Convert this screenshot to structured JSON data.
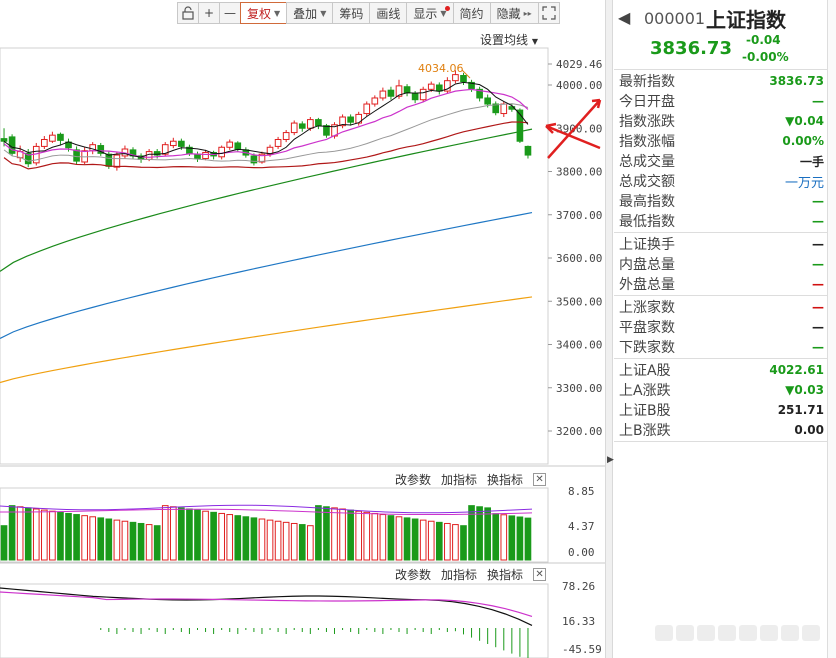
{
  "toolbar": {
    "items": [
      {
        "label": "",
        "icon": "lock-icon"
      },
      {
        "label": "+",
        "icon": "zoom-in-icon"
      },
      {
        "label": "—",
        "icon": "zoom-out-icon"
      },
      {
        "label": "复权",
        "dropdown": true,
        "active": true
      },
      {
        "label": "叠加",
        "dropdown": true
      },
      {
        "label": "筹码"
      },
      {
        "label": "画线"
      },
      {
        "label": "显示",
        "dropdown": true,
        "badge": true
      },
      {
        "label": "简约"
      },
      {
        "label": "隐藏",
        "suffix": "▸▸"
      },
      {
        "label": "",
        "icon": "fullscreen-icon"
      }
    ]
  },
  "main_chart": {
    "setting_label": "设置均线",
    "high_label": "4034.06",
    "y_axis_ticks": [
      "4029.46",
      "4000.00",
      "3900.00",
      "3800.00",
      "3700.00",
      "3600.00",
      "3500.00",
      "3400.00",
      "3300.00",
      "3200.00"
    ]
  },
  "volume_panel": {
    "buttons": [
      "改参数",
      "加指标",
      "换指标"
    ],
    "y_axis_ticks": [
      "8.85",
      "4.37",
      "0.00"
    ]
  },
  "macd_panel": {
    "buttons": [
      "改参数",
      "加指标",
      "换指标"
    ],
    "y_axis_ticks": [
      "78.26",
      "16.33",
      "-45.59"
    ]
  },
  "quote": {
    "code": "000001",
    "name": "上证指数",
    "price": "3836.73",
    "change": "-0.04",
    "change_pct": "-0.00%",
    "groups": [
      [
        {
          "label": "最新指数",
          "value": "3836.73",
          "color": "green"
        },
        {
          "label": "今日开盘",
          "value": "—",
          "color": "green"
        },
        {
          "label": "指数涨跌",
          "value": "▼0.04",
          "color": "green"
        },
        {
          "label": "指数涨幅",
          "value": "0.00%",
          "color": "green"
        },
        {
          "label": "总成交量",
          "value": "一手",
          "color": "dark"
        },
        {
          "label": "总成交额",
          "value": "一万元",
          "color": "blue"
        },
        {
          "label": "最高指数",
          "value": "—",
          "color": "green"
        },
        {
          "label": "最低指数",
          "value": "—",
          "color": "green"
        }
      ],
      [
        {
          "label": "上证换手",
          "value": "—",
          "color": "dark"
        },
        {
          "label": "内盘总量",
          "value": "—",
          "color": "green"
        },
        {
          "label": "外盘总量",
          "value": "—",
          "color": "red"
        }
      ],
      [
        {
          "label": "上涨家数",
          "value": "—",
          "color": "red"
        },
        {
          "label": "平盘家数",
          "value": "—",
          "color": "dark"
        },
        {
          "label": "下跌家数",
          "value": "—",
          "color": "green"
        }
      ],
      [
        {
          "label": "上证A股",
          "value": "4022.61",
          "color": "green"
        },
        {
          "label": "上A涨跌",
          "value": "▼0.03",
          "color": "green"
        },
        {
          "label": "上证B股",
          "value": "251.71",
          "color": "dark"
        },
        {
          "label": "上B涨跌",
          "value": "0.00",
          "color": "dark"
        }
      ]
    ]
  },
  "colors": {
    "up": "#e02020",
    "down": "#1a9a1a",
    "ma5": "#111111",
    "ma10": "#cc33cc",
    "ma20": "#999999",
    "ma30": "#b01818",
    "ma60": "#1a8a1a",
    "ma120": "#1f77c4",
    "ma250": "#f0a010",
    "annotation_arrow": "#e02020"
  }
}
